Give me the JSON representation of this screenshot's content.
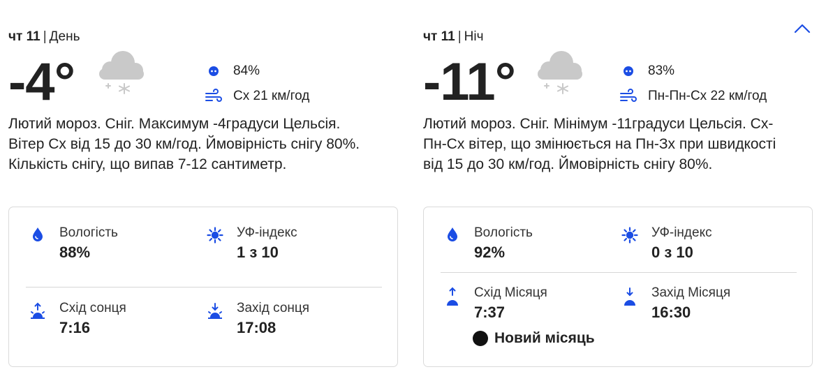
{
  "day": {
    "date": "чт 11",
    "separator": "|",
    "period": "День",
    "temperature": "-4°",
    "weather_icon": "cloud-snow-icon",
    "precip_label": "84%",
    "wind_label": "Сх 21 км/год",
    "description": "Лютий мороз. Сніг. Максимум -4градуси Цельсія. Вітер Сх від 15 до 30 км/год. Ймовірність снігу 80%. Кількість снігу, що випав 7-12 сантиметр.",
    "details": {
      "humidity_label": "Вологість",
      "humidity_value": "88%",
      "uv_label": "УФ-індекс",
      "uv_value": "1 з 10",
      "rise_label": "Схід сонця",
      "rise_value": "7:16",
      "set_label": "Захід сонця",
      "set_value": "17:08"
    }
  },
  "night": {
    "date": "чт 11",
    "separator": "|",
    "period": "Ніч",
    "temperature": "-11°",
    "weather_icon": "cloud-snow-icon",
    "precip_label": "83%",
    "wind_label": "Пн-Пн-Сх 22 км/год",
    "description": "Лютий мороз. Сніг. Мінімум -11градуси Цельсія. Сх-Пн-Сх вітер, що змінюється на Пн-Зх при швидкості від 15 до 30 км/год. Ймовірність снігу 80%.",
    "details": {
      "humidity_label": "Вологість",
      "humidity_value": "92%",
      "uv_label": "УФ-індекс",
      "uv_value": "0 з 10",
      "rise_label": "Схід Місяця",
      "rise_value": "7:37",
      "set_label": "Захід Місяця",
      "set_value": "16:30",
      "moon_phase": "Новий місяць"
    }
  },
  "colors": {
    "accent": "#1b4de4",
    "text": "#222222",
    "cloud": "#c9c9c9",
    "border": "#dadada"
  }
}
